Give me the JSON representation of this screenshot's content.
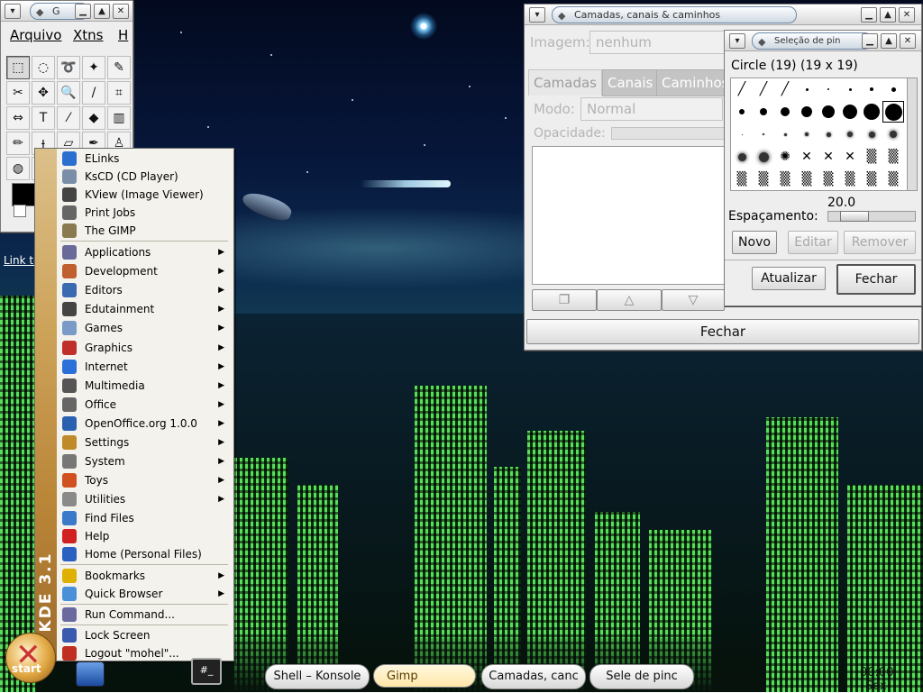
{
  "toolbox": {
    "title_pill": "G",
    "menu": [
      "Arquivo",
      "Xtns",
      "H"
    ],
    "tool_icons": [
      "rect-select-icon",
      "ellipse-select-icon",
      "lasso-icon",
      "fuzzy-select-icon",
      "bezier-icon",
      "scissors-icon",
      "move-icon",
      "zoom-icon",
      "pencil-icon",
      "crop-icon",
      "flip-icon",
      "text-icon",
      "color-picker-icon",
      "bucket-fill-icon",
      "gradient-icon",
      "pencil2-icon",
      "paintbrush-icon",
      "eraser-icon",
      "airbrush-icon",
      "clone-icon",
      "smudge-icon",
      "dodge-icon"
    ]
  },
  "desktop": {
    "link_label": "Link to"
  },
  "layers_window": {
    "title": "Camadas, canais & caminhos",
    "image_label": "Imagem:",
    "image_value": "nenhum",
    "tabs": [
      "Camadas",
      "Canais",
      "Caminhos"
    ],
    "mode_label": "Modo:",
    "mode_value": "Normal",
    "opacity_label": "Opacidade:",
    "bottom_icons": [
      "new-layer-icon",
      "raise-icon",
      "lower-icon"
    ],
    "close_label": "Fechar"
  },
  "brush_window": {
    "title": "Seleção de pin",
    "brush_name": "Circle (19)  (19 x 19)",
    "spacing_value": "20.0",
    "spacing_label": "Espaçamento:",
    "spacing_level": 0.2,
    "new_label": "Novo",
    "edit_label": "Editar",
    "remove_label": "Remover",
    "refresh_label": "Atualizar",
    "close_label": "Fechar"
  },
  "kmenu": {
    "brand": "KDE 3.1",
    "recent": [
      {
        "label": "ELinks",
        "icon": "elinks-icon"
      },
      {
        "label": "KsCD (CD Player)",
        "icon": "cd-player-icon"
      },
      {
        "label": "KView (Image Viewer)",
        "icon": "image-viewer-icon"
      },
      {
        "label": "Print Jobs",
        "icon": "printer-icon"
      },
      {
        "label": "The GIMP",
        "icon": "gimp-icon"
      }
    ],
    "categories": [
      {
        "label": "Applications",
        "icon": "applications-icon"
      },
      {
        "label": "Development",
        "icon": "development-icon"
      },
      {
        "label": "Editors",
        "icon": "editors-icon"
      },
      {
        "label": "Edutainment",
        "icon": "edutainment-icon"
      },
      {
        "label": "Games",
        "icon": "games-icon"
      },
      {
        "label": "Graphics",
        "icon": "graphics-icon"
      },
      {
        "label": "Internet",
        "icon": "internet-icon"
      },
      {
        "label": "Multimedia",
        "icon": "multimedia-icon"
      },
      {
        "label": "Office",
        "icon": "office-icon"
      },
      {
        "label": "OpenOffice.org 1.0.0",
        "icon": "openoffice-icon"
      },
      {
        "label": "Settings",
        "icon": "settings-icon"
      },
      {
        "label": "System",
        "icon": "system-icon"
      },
      {
        "label": "Toys",
        "icon": "toys-icon"
      },
      {
        "label": "Utilities",
        "icon": "utilities-icon"
      }
    ],
    "actions": [
      {
        "label": "Find Files",
        "icon": "find-files-icon"
      },
      {
        "label": "Help",
        "icon": "help-icon"
      },
      {
        "label": "Home (Personal Files)",
        "icon": "home-icon"
      }
    ],
    "browsers": [
      {
        "label": "Bookmarks",
        "icon": "bookmarks-icon"
      },
      {
        "label": "Quick Browser",
        "icon": "quick-browser-icon"
      }
    ],
    "run": {
      "label": "Run Command...",
      "icon": "run-command-icon"
    },
    "session": [
      {
        "label": "Lock Screen",
        "icon": "lock-icon"
      },
      {
        "label": "Logout \"mohel\"...",
        "icon": "logout-icon"
      }
    ]
  },
  "taskbar": {
    "start_label": "start",
    "tasks": [
      "Shell – Konsole",
      "Gimp",
      "Camadas, canc",
      "Sele de pinc"
    ],
    "clock": "00:00",
    "day": "Sex"
  },
  "colors": {
    "menu_bg": "#f4f2ec",
    "menu_sidebar": "#cda35a",
    "window_bg": "#eeeeee",
    "city_green": "#56e05a"
  }
}
